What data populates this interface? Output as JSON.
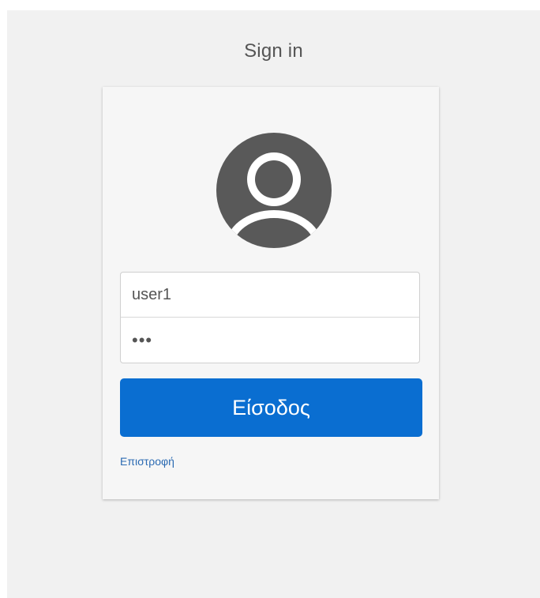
{
  "page": {
    "title": "Sign in"
  },
  "login": {
    "avatar_icon": "user-avatar-icon",
    "username_value": "user1",
    "password_value": "•••",
    "submit_label": "Είσοδος",
    "back_label": "Επιστροφή"
  },
  "colors": {
    "background": "#f1f1f1",
    "card": "#f6f6f6",
    "primary_button": "#0a6ed1",
    "link": "#2b6ab2",
    "avatar": "#595959"
  }
}
